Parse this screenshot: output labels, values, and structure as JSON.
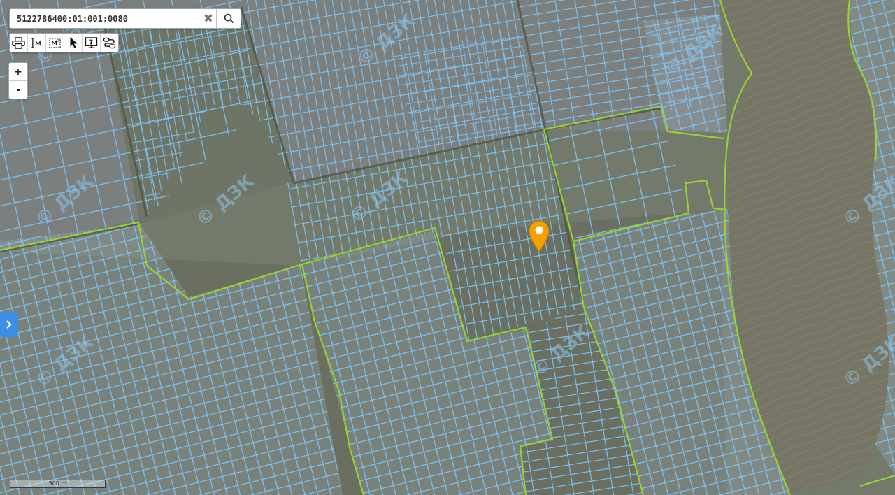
{
  "search": {
    "value": "5122786400:01:001:0080",
    "clear_symbol": "✖"
  },
  "toolbar": {
    "tools": [
      {
        "icon": "printer-icon"
      },
      {
        "icon": "measure-distance-icon"
      },
      {
        "icon": "measure-area-icon"
      },
      {
        "icon": "select-pointer-icon"
      },
      {
        "icon": "identify-info-icon"
      },
      {
        "icon": "route-icon"
      }
    ]
  },
  "zoom": {
    "in_label": "+",
    "out_label": "-"
  },
  "side_panel": {
    "toggle_symbol": "›"
  },
  "map": {
    "watermark_text": "© ДЗК",
    "marker_color": "#f5a000",
    "parcel_outline_color": "#7fc4f5",
    "boundary_color": "#9ad632",
    "water_color": "#777565"
  },
  "scale_bar": {
    "label": "500 m"
  }
}
